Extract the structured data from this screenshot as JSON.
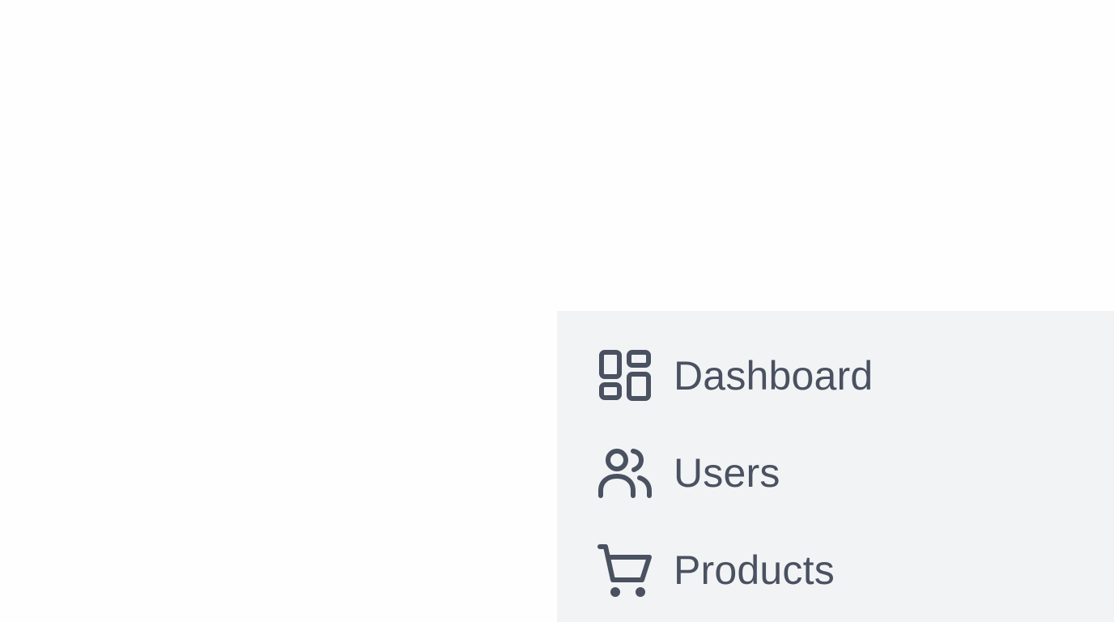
{
  "colors": {
    "page_background": "#fefefe",
    "panel_background": "#f2f3f5",
    "text": "#4a5160"
  },
  "sidebar": {
    "items": [
      {
        "label": "Dashboard",
        "icon": "dashboard-icon"
      },
      {
        "label": "Users",
        "icon": "users-icon"
      },
      {
        "label": "Products",
        "icon": "shopping-cart-icon"
      }
    ]
  }
}
